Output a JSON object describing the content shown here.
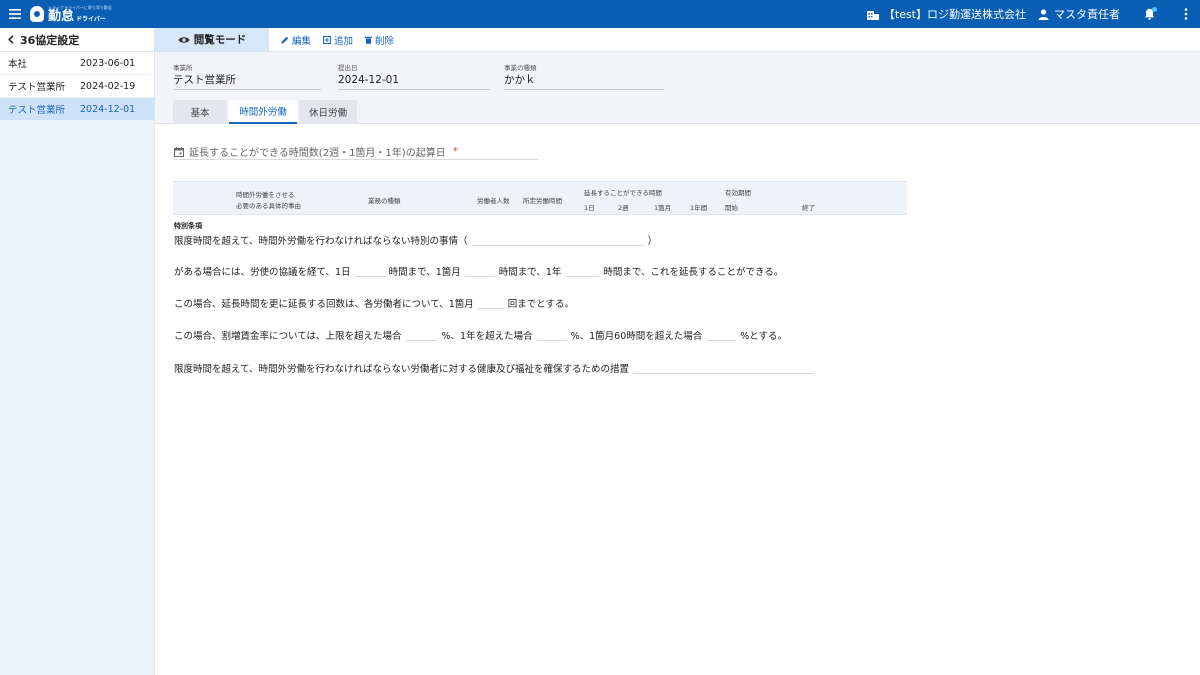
{
  "topbar": {
    "logo_tagline": "トラックドライバーに寄り添う勤怠",
    "logo_main": "勤怠",
    "logo_sub": "ドライバー",
    "company": "【test】ロジ勤運送株式会社",
    "user": "マスタ責任者"
  },
  "sidebar": {
    "back_label": "36協定設定",
    "items": [
      {
        "name": "本社",
        "date": "2023-06-01"
      },
      {
        "name": "テスト営業所",
        "date": "2024-02-19"
      },
      {
        "name": "テスト営業所",
        "date": "2024-12-01"
      }
    ]
  },
  "actionbar": {
    "mode_label": "閲覧モード",
    "edit_label": "編集",
    "add_label": "追加",
    "delete_label": "削除"
  },
  "header": {
    "office_label": "事業所",
    "office_value": "テスト営業所",
    "submit_label": "提出日",
    "submit_value": "2024-12-01",
    "business_label": "事業の種類",
    "business_value": "かかｋ"
  },
  "tabs": [
    "基本",
    "時間外労働",
    "休日労働"
  ],
  "content": {
    "date_field_label": "延長することができる時間数(2週・1箇月・1年)の起算日",
    "table_head": {
      "reason_line1": "時間外労働をさせる",
      "reason_line2": "必要のある具体的事由",
      "business_type": "業務の種類",
      "worker_count": "労働者人数",
      "regular_hours": "所定労働時間",
      "extension_title": "延長することができる時間",
      "day": "1日",
      "two_weeks": "2週",
      "month": "1箇月",
      "year": "1年間",
      "validity_title": "有効期間",
      "start": "開始",
      "end": "終了"
    },
    "special_label": "特別条項",
    "line1_a": "限度時間を超えて、時間外労働を行わなければならない特別の事情（",
    "line1_b": "）",
    "line2_a": "がある場合には、労使の協議を経て、1日",
    "line2_b": "時間まで、1箇月",
    "line2_c": "時間まで、1年",
    "line2_d": "時間まで、これを延長することができる。",
    "line3_a": "この場合、延長時間を更に延長する回数は、各労働者について、1箇月",
    "line3_b": "回までとする。",
    "line4_a": "この場合、割増賃金率については、上限を超えた場合",
    "line4_b": "%、1年を超えた場合",
    "line4_c": "%、1箇月60時間を超えた場合",
    "line4_d": "%とする。",
    "line5_a": "限度時間を超えて、時間外労働を行わなければならない労働者に対する健康及び福祉を確保するための措置"
  },
  "colors": {
    "brand": "#0a5fb4",
    "accent": "#1565c0",
    "required": "#e53935"
  }
}
